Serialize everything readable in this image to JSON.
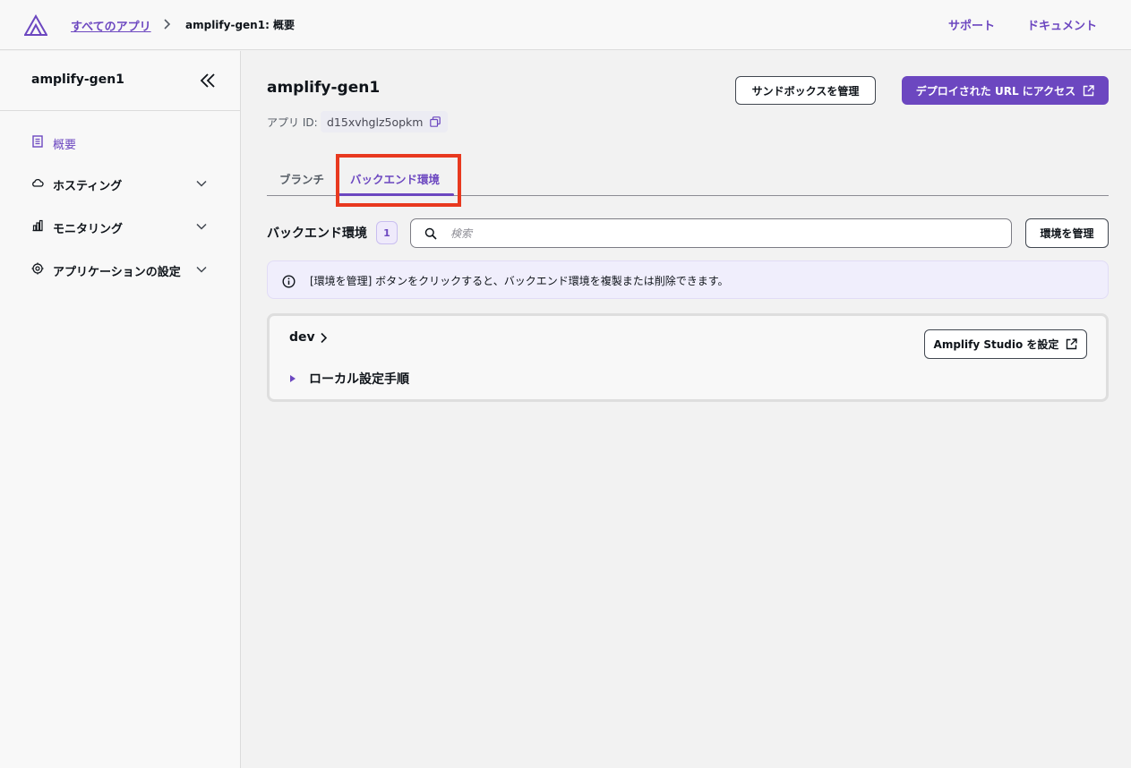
{
  "header": {
    "breadcrumb_all_apps": "すべてのアプリ",
    "breadcrumb_current": "amplify-gen1: 概要",
    "support": "サポート",
    "docs": "ドキュメント"
  },
  "sidebar": {
    "title": "amplify-gen1",
    "items": [
      {
        "label": "概要",
        "icon": "document-icon",
        "active": true
      },
      {
        "label": "ホスティング",
        "icon": "cloud-icon"
      },
      {
        "label": "モニタリング",
        "icon": "bar-chart-icon"
      },
      {
        "label": "アプリケーションの設定",
        "icon": "gear-icon"
      }
    ]
  },
  "main": {
    "title": "amplify-gen1",
    "app_id_label": "アプリ ID:",
    "app_id_value": "d15xvhglz5opkm",
    "sandbox_button": "サンドボックスを管理",
    "deploy_button": "デプロイされた URL にアクセス",
    "tabs": [
      {
        "label": "ブランチ"
      },
      {
        "label": "バックエンド環境",
        "active": true
      }
    ],
    "section_title": "バックエンド環境",
    "count": "1",
    "search_placeholder": "検索",
    "manage_button": "環境を管理",
    "info_text": "[環境を管理] ボタンをクリックすると、バックエンド環境を複製または削除できます。",
    "env": {
      "name": "dev",
      "studio_button": "Amplify Studio を設定",
      "local_setup": "ローカル設定手順"
    }
  },
  "colors": {
    "accent": "#6c47c0",
    "highlight": "#e8391f"
  }
}
